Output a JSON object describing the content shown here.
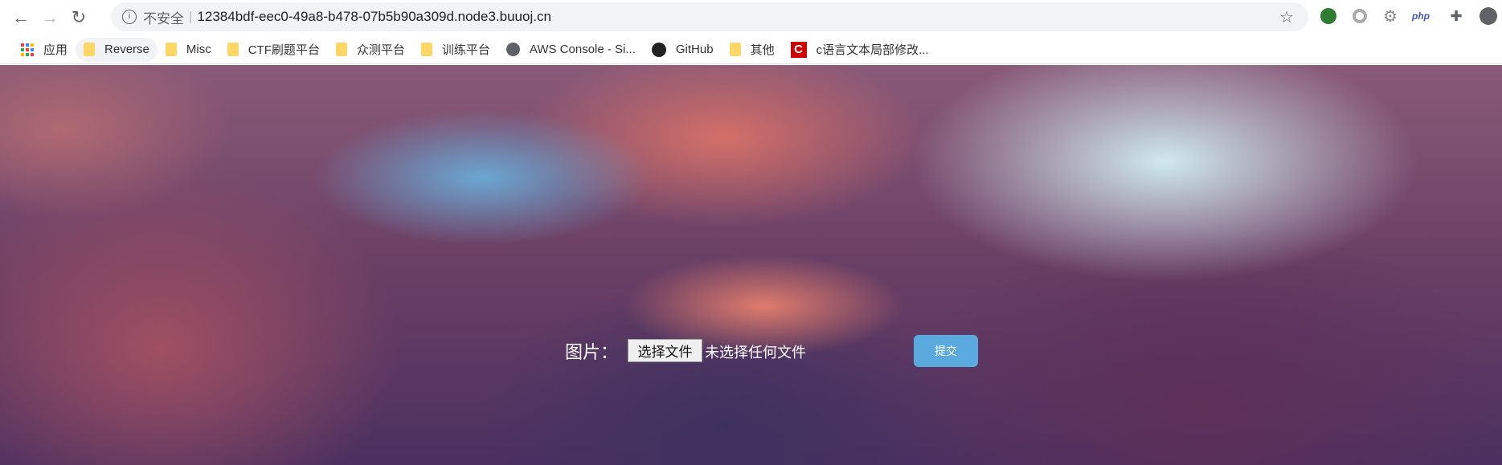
{
  "browser": {
    "security_label": "不安全",
    "url": "12384bdf-eec0-49a8-b478-07b5b90a309d.node3.buuoj.cn",
    "extensions": [
      "green-ext-icon",
      "circle-ext-icon",
      "gear-ext-icon",
      "php",
      "puzzle-icon",
      "profile-icon"
    ],
    "php_label": "php"
  },
  "bookmarks": [
    {
      "label": "应用",
      "icon": "apps-icon"
    },
    {
      "label": "Reverse",
      "icon": "folder-icon"
    },
    {
      "label": "Misc",
      "icon": "folder-icon"
    },
    {
      "label": "CTF刷题平台",
      "icon": "folder-icon"
    },
    {
      "label": "众测平台",
      "icon": "folder-icon"
    },
    {
      "label": "训练平台",
      "icon": "folder-icon"
    },
    {
      "label": "AWS Console - Si...",
      "icon": "globe-icon"
    },
    {
      "label": "GitHub",
      "icon": "github-icon"
    },
    {
      "label": "其他",
      "icon": "folder-icon"
    },
    {
      "label": "c语言文本局部修改...",
      "icon": "csdn-icon"
    }
  ],
  "form": {
    "label": "图片：",
    "choose_button": "选择文件",
    "no_file": "未选择任何文件",
    "submit": "提交"
  }
}
